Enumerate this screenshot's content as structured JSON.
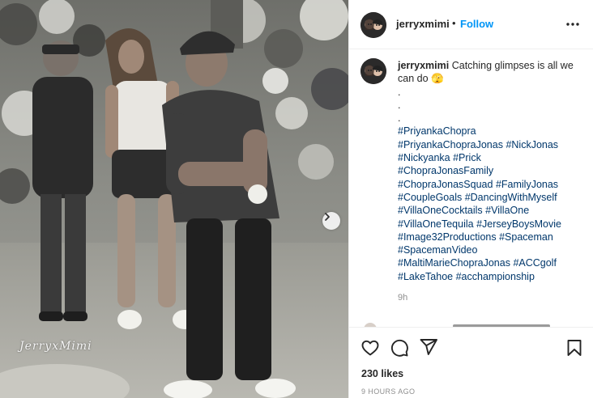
{
  "post": {
    "username": "jerryxmimi",
    "separator": "•",
    "follow_label": "Follow",
    "watermark": "JerryxMimi"
  },
  "caption": {
    "username": "jerryxmimi",
    "text": "Catching glimpses is all we can do 🫣",
    "dot_lines": [
      ".",
      ".",
      "."
    ],
    "hashtag_lines": [
      [
        "#PriyankaChopra"
      ],
      [
        "#PriyankaChopraJonas",
        "#NickJonas"
      ],
      [
        "#Nickyanka",
        "#Prick"
      ],
      [
        "#ChopraJonasFamily"
      ],
      [
        "#ChopraJonasSquad",
        "#FamilyJonas"
      ],
      [
        "#CoupleGoals",
        "#DancingWithMyself"
      ],
      [
        "#VillaOneCocktails",
        "#VillaOne"
      ],
      [
        "#VillaOneTequila",
        "#JerseyBoysMovie"
      ],
      [
        "#Image32Productions",
        "#Spaceman"
      ],
      [
        "#SpacemanVideo"
      ],
      [
        "#MaltiMarieChopraJonas",
        "#ACCgolf"
      ],
      [
        "#LakeTahoe",
        "#acchampionship"
      ]
    ],
    "time": "9h"
  },
  "actions": {
    "likes": "230 likes",
    "time_ago": "9 HOURS AGO"
  },
  "icons": {
    "like": "heart-icon",
    "comment": "comment-icon",
    "share": "share-icon",
    "save": "bookmark-icon",
    "more": "more-options-icon",
    "next": "chevron-right-icon"
  },
  "colors": {
    "link": "#00376b",
    "follow": "#0095f6",
    "text": "#262626",
    "muted": "#8e8e8e"
  }
}
